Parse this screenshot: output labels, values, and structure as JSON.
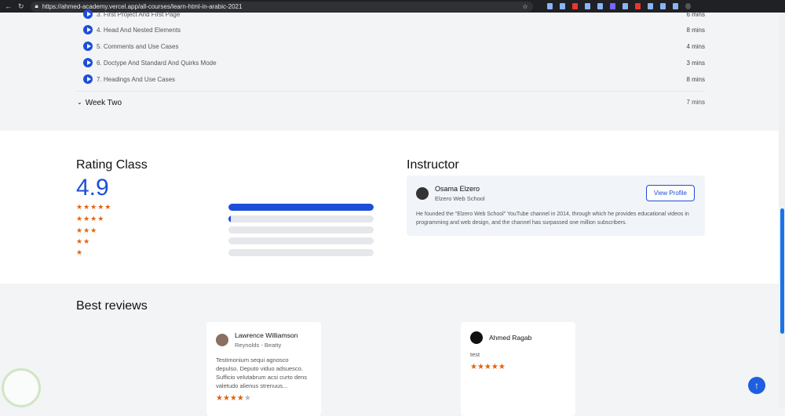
{
  "browser": {
    "url": "https://ahmed-academy.vercel.app/all-courses/learn-html-in-arabic-2021"
  },
  "lessons": [
    {
      "title": "3. First Project And First Page",
      "duration": "6 mins"
    },
    {
      "title": "4. Head And Nested Elements",
      "duration": "8 mins"
    },
    {
      "title": "5. Comments and Use Cases",
      "duration": "4 mins"
    },
    {
      "title": "6. Doctype And Standard And Quirks Mode",
      "duration": "3 mins"
    },
    {
      "title": "7. Headings And Use Cases",
      "duration": "8 mins"
    }
  ],
  "week_two": {
    "label": "Week Two",
    "duration": "7 mins"
  },
  "rating": {
    "heading": "Rating Class",
    "score": "4.9",
    "bars": [
      {
        "stars": "★★★★★",
        "fill": 100
      },
      {
        "stars": "★★★★",
        "fill": 1
      },
      {
        "stars": "★★★",
        "fill": 0
      },
      {
        "stars": "★★",
        "fill": 0
      },
      {
        "stars": "★",
        "fill": 0
      }
    ]
  },
  "instructor": {
    "heading": "Instructor",
    "name": "Osama Elzero",
    "org": "Elzero Web School",
    "button": "View Profile",
    "bio": "He founded the \"Elzero Web School\" YouTube channel in 2014, through which he provides educational videos in programming and web design, and the channel has surpassed one million subscribers."
  },
  "reviews": {
    "heading": "Best reviews",
    "items": [
      {
        "name": "Lawrence Williamson",
        "company": "Reynolds - Beatty",
        "text": "Testimonium sequi agnosco depulso. Deputo viduo adsuesco. Sufficio velutabrum acsi curto dens valetudo alienus strenuus...",
        "rating": 4
      },
      {
        "name": "Ahmed Ragab",
        "company": "",
        "text": "test",
        "rating": 5
      }
    ]
  },
  "colors": {
    "accent": "#1d4ed8",
    "star": "#e0630f"
  }
}
